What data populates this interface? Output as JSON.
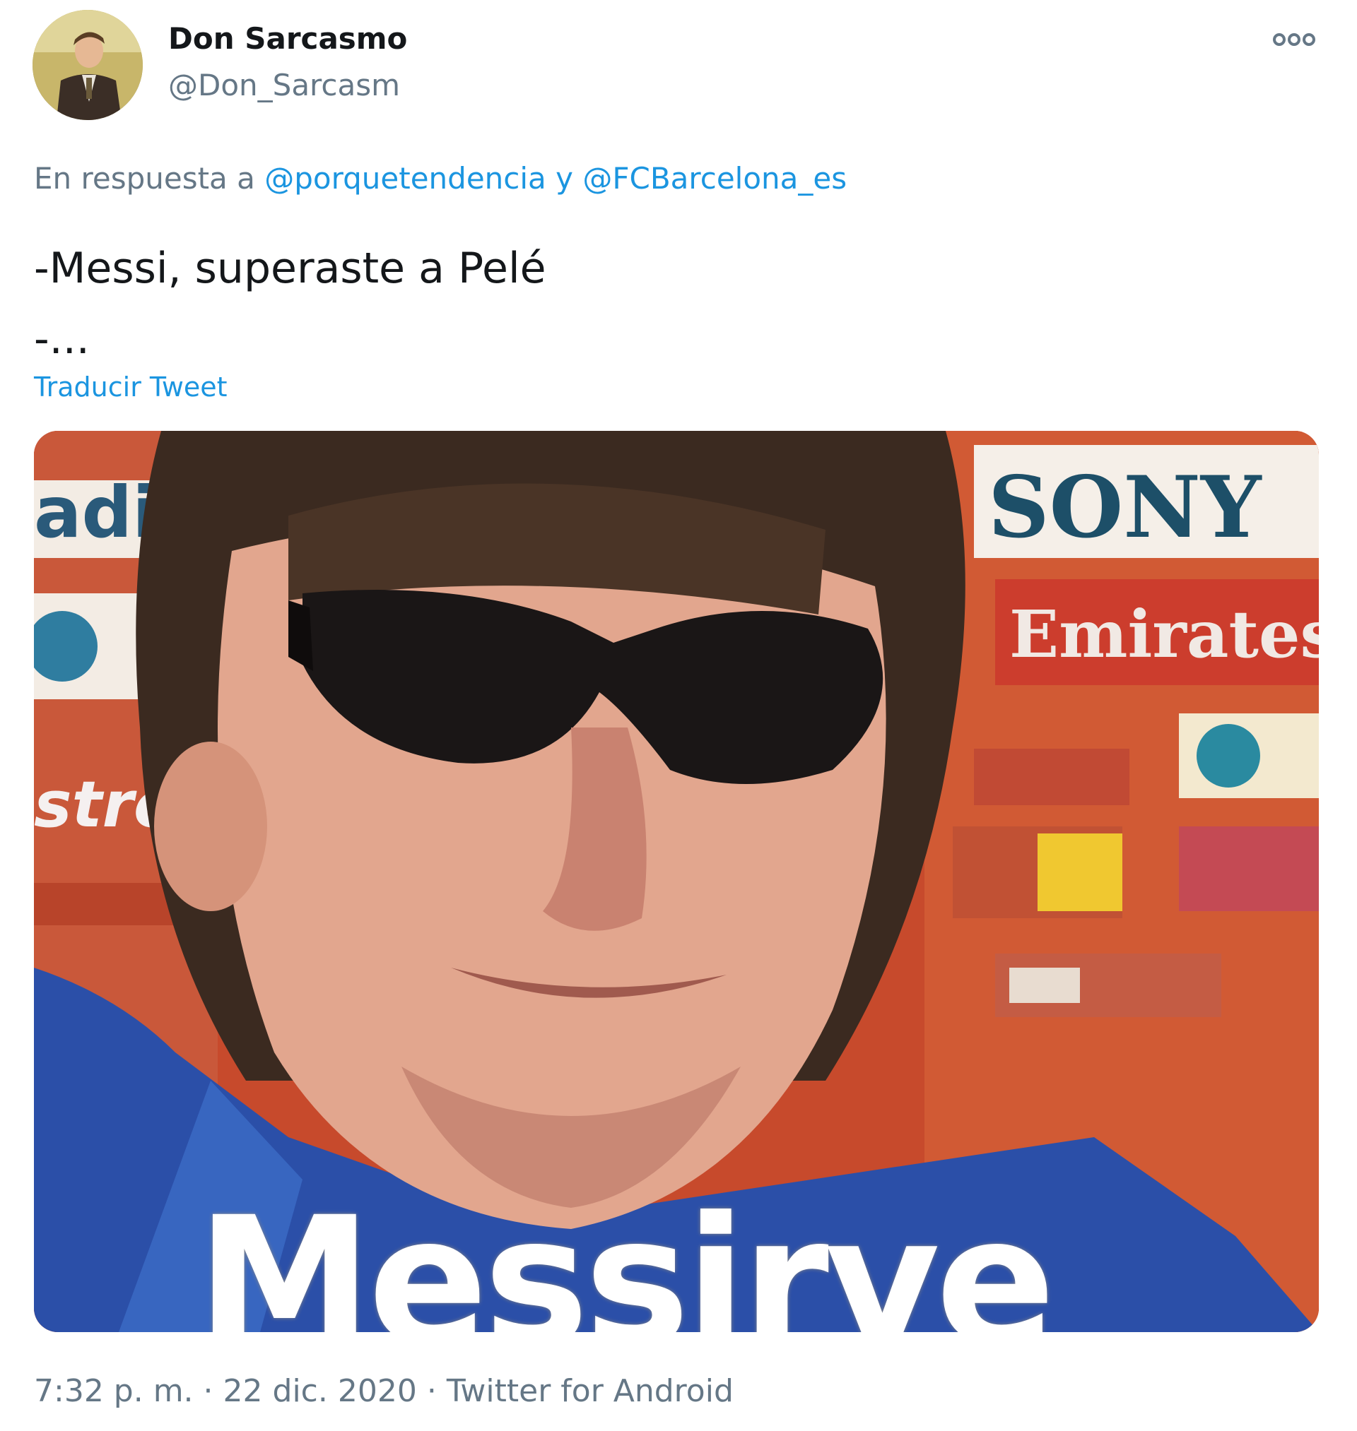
{
  "author": {
    "display_name": "Don Sarcasmo",
    "handle": "@Don_Sarcasm"
  },
  "reply_to": {
    "prefix": "En respuesta a",
    "mention_1": "@porquetendencia",
    "conjunction": "y",
    "mention_2": "@FCBarcelona_es"
  },
  "tweet": {
    "text_line_1": "-Messi, superaste a Pelé",
    "text_line_2": "-...",
    "translate_label": "Traducir Tweet"
  },
  "media": {
    "caption_text": "Messirve",
    "sponsor_labels": [
      "SONY",
      "Emirates",
      "adi",
      "strom"
    ]
  },
  "meta": {
    "time": "7:32 p. m.",
    "separator": "·",
    "date": "22 dic. 2020",
    "source": "Twitter for Android"
  },
  "icons": {
    "more": "more-options-icon"
  },
  "colors": {
    "link": "#1b95e0",
    "secondary_text": "#657786",
    "primary_text": "#14171a",
    "backdrop_red": "#c74a2c"
  }
}
